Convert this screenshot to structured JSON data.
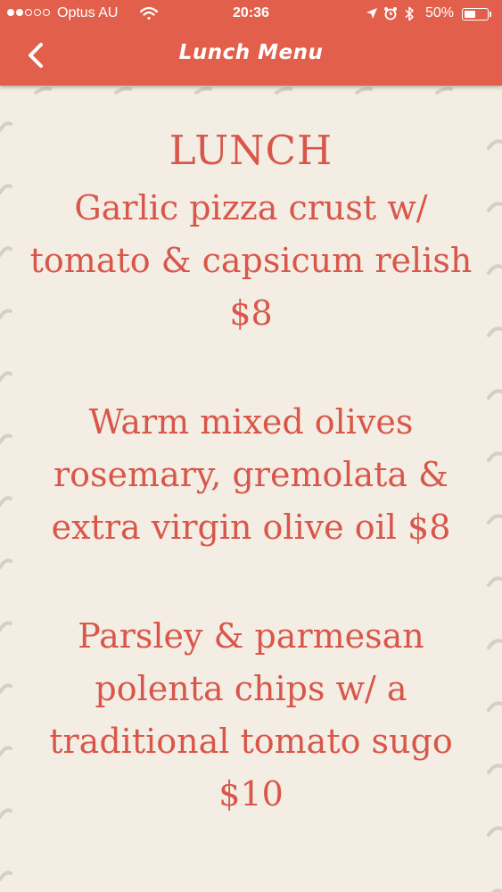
{
  "status_bar": {
    "signal_bars_filled": 2,
    "signal_bars_total": 5,
    "carrier": "Optus AU",
    "time": "20:36",
    "battery_percent": "50%",
    "battery_level": 0.5,
    "icons": [
      "wifi-icon",
      "location-arrow-icon",
      "alarm-clock-icon",
      "bluetooth-icon",
      "battery-icon"
    ]
  },
  "nav": {
    "back_icon": "chevron-left-icon",
    "title": "Lunch Menu"
  },
  "menu": {
    "heading": "LUNCH",
    "items": [
      "Garlic pizza crust w/ tomato & capsicum relish $8",
      "Warm mixed olives rosemary, gremolata & extra virgin olive oil $8",
      "Parsley & parmesan polenta chips w/ a traditional tomato sugo $10"
    ]
  },
  "colors": {
    "header": "#e2604b",
    "background": "#f3ede3",
    "menu_text": "#d8574a",
    "status_text": "#ffffff"
  }
}
